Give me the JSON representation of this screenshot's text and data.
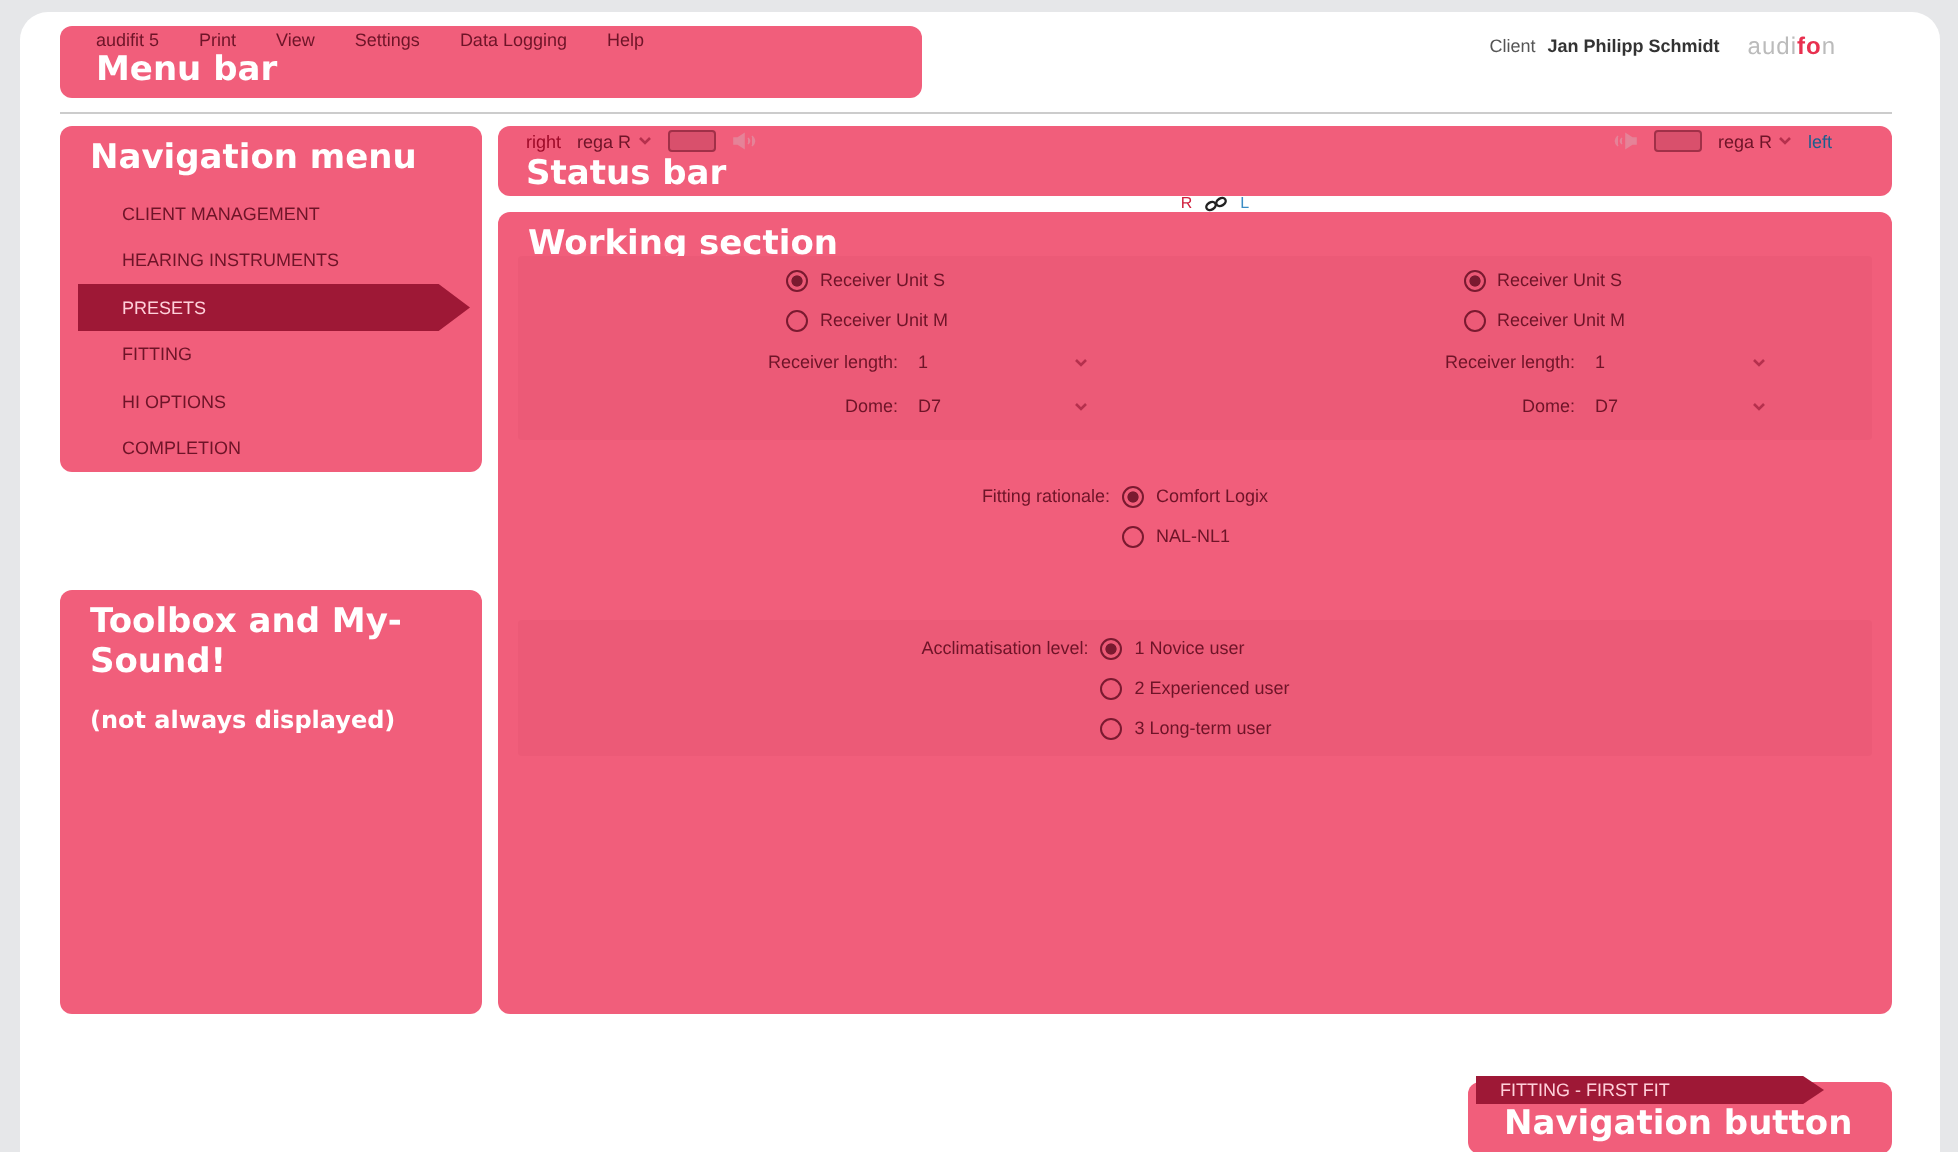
{
  "menu_bar": {
    "annotation": "Menu bar",
    "items": [
      "audifit 5",
      "Print",
      "View",
      "Settings",
      "Data Logging",
      "Help"
    ]
  },
  "client": {
    "label": "Client",
    "name": "Jan Philipp Schmidt"
  },
  "logo": "audi**fo**n",
  "navigation_menu": {
    "annotation": "Navigation menu",
    "items": [
      {
        "label": "CLIENT MANAGEMENT",
        "selected": false
      },
      {
        "label": "HEARING INSTRUMENTS",
        "selected": false
      },
      {
        "label": "PRESETS",
        "selected": true
      },
      {
        "label": "FITTING",
        "selected": false
      },
      {
        "label": "HI OPTIONS",
        "selected": false
      },
      {
        "label": "COMPLETION",
        "selected": false
      }
    ]
  },
  "toolbox": {
    "annotation": "Toolbox and My-Sound!",
    "note": "(not always displayed)"
  },
  "status_bar": {
    "annotation": "Status bar",
    "right": {
      "side": "right",
      "device": "rega R"
    },
    "left": {
      "side": "left",
      "device": "rega R"
    }
  },
  "link": {
    "right": "R",
    "left": "L"
  },
  "working_section": {
    "annotation": "Working section",
    "sides": [
      {
        "receivers": [
          {
            "label": "Receiver Unit S",
            "selected": true
          },
          {
            "label": "Receiver Unit M",
            "selected": false
          }
        ],
        "receiver_length": {
          "label": "Receiver length:",
          "value": "1"
        },
        "dome": {
          "label": "Dome:",
          "value": "D7"
        }
      },
      {
        "receivers": [
          {
            "label": "Receiver Unit S",
            "selected": true
          },
          {
            "label": "Receiver Unit M",
            "selected": false
          }
        ],
        "receiver_length": {
          "label": "Receiver length:",
          "value": "1"
        },
        "dome": {
          "label": "Dome:",
          "value": "D7"
        }
      }
    ],
    "fitting_rationale": {
      "label": "Fitting rationale:",
      "options": [
        {
          "label": "Comfort Logix",
          "selected": true
        },
        {
          "label": "NAL-NL1",
          "selected": false
        }
      ]
    },
    "acclimatisation": {
      "label": "Acclimatisation level:",
      "options": [
        {
          "label": "1 Novice user",
          "selected": true
        },
        {
          "label": "2 Experienced user",
          "selected": false
        },
        {
          "label": "3 Long-term user",
          "selected": false
        }
      ]
    }
  },
  "navigation_button": {
    "annotation": "Navigation button",
    "label": "FITTING - FIRST FIT"
  }
}
